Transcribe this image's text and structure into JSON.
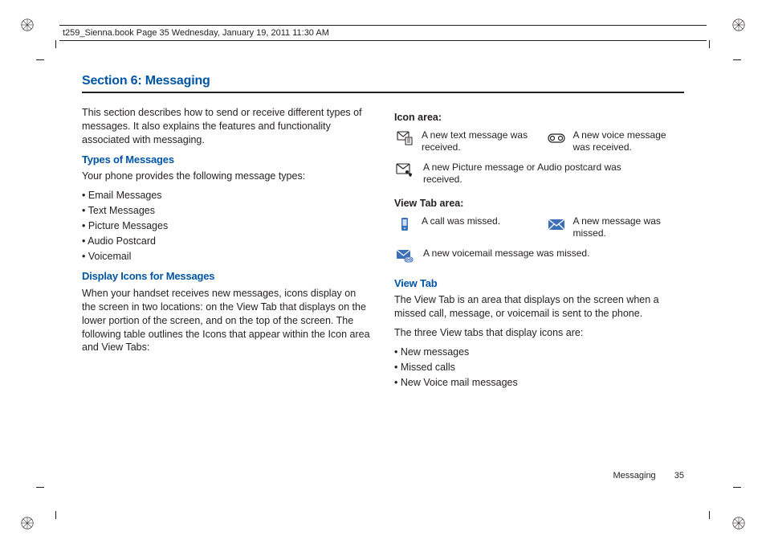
{
  "header": {
    "running_text": "t259_Sienna.book  Page 35  Wednesday, January 19, 2011  11:30 AM"
  },
  "section_title": "Section 6: Messaging",
  "left": {
    "intro": "This section describes how to send or receive different types of messages. It also explains the features and functionality associated with messaging.",
    "types_h": "Types of Messages",
    "types_intro": "Your phone provides the following message types:",
    "types_list": {
      "0": "Email Messages",
      "1": "Text Messages",
      "2": "Picture Messages",
      "3": "Audio Postcard",
      "4": "Voicemail"
    },
    "icons_h": "Display Icons for Messages",
    "icons_p": "When your handset receives new messages, icons display on the screen in two locations: on the View Tab that displays on the lower portion of the screen, and on the top of the screen. The following table outlines the Icons that appear within the Icon area and View Tabs:"
  },
  "right": {
    "icon_area_h": "Icon area:",
    "icon_area": {
      "text_msg": "A new text message was received.",
      "voice_msg": "A new voice message was received.",
      "picture_msg": "A new Picture message or Audio postcard was received."
    },
    "view_tab_area_h": "View Tab area:",
    "view_tab_area": {
      "missed_call": "A call was missed.",
      "missed_msg": "A new message was missed.",
      "missed_vm": "A new voicemail message was missed."
    },
    "view_tab_h": "View Tab",
    "view_tab_p1": "The View Tab is an area that displays on the screen when a missed call, message, or voicemail is sent to the phone.",
    "view_tab_p2": "The three View tabs that display icons are:",
    "view_tab_list": {
      "0": "New messages",
      "1": "Missed calls",
      "2": "New Voice mail messages"
    }
  },
  "footer": {
    "label": "Messaging",
    "page": "35"
  }
}
